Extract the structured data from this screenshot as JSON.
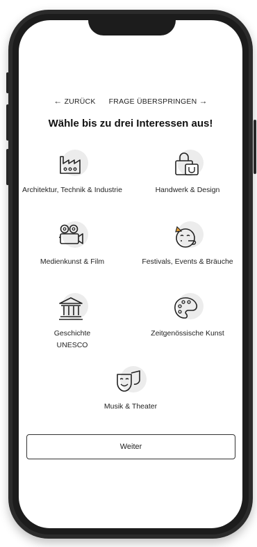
{
  "nav": {
    "back_arrow": "←",
    "back_label": "ZURÜCK",
    "skip_label": "FRAGE ÜBERSPRINGEN",
    "skip_arrow": "→"
  },
  "title": "Wähle bis zu drei Interessen aus!",
  "interests": [
    {
      "label": "Architektur, Technik & Industrie",
      "icon": "factory-icon"
    },
    {
      "label": "Handwerk & Design",
      "icon": "bag-icon"
    },
    {
      "label": "Medienkunst & Film",
      "icon": "video-camera-icon"
    },
    {
      "label": "Festivals, Events & Bräuche",
      "icon": "party-face-icon"
    },
    {
      "label": "Geschichte UNESCO",
      "icon": "museum-icon"
    },
    {
      "label": "Zeitgenössische Kunst",
      "icon": "palette-icon"
    },
    {
      "label": "Musik & Theater",
      "icon": "theater-masks-icon"
    }
  ],
  "continue_label": "Weiter"
}
